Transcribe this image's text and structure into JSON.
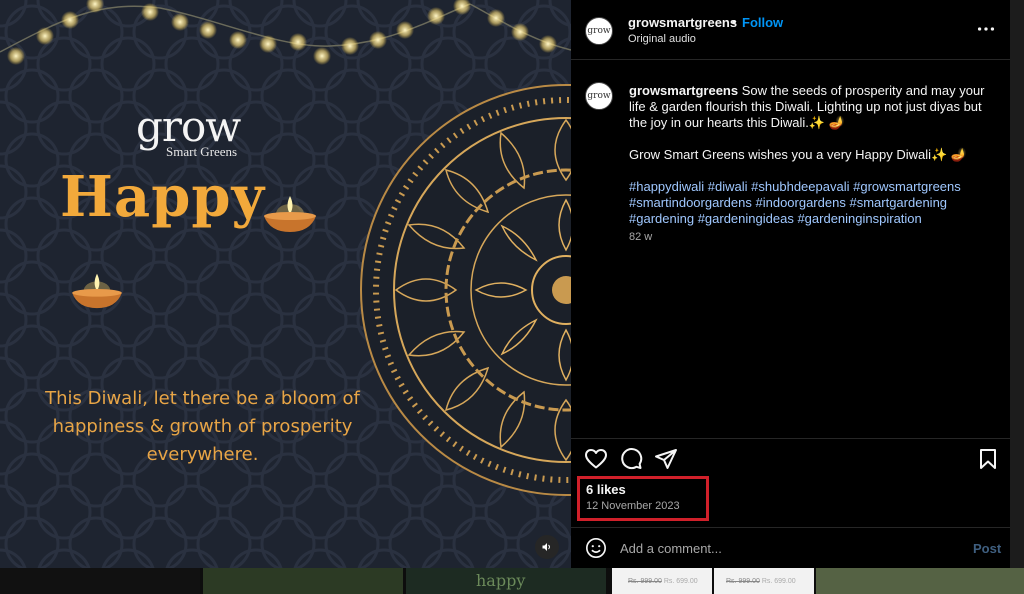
{
  "post": {
    "username": "growsmartgreens",
    "follow_label": "Follow",
    "separator": "•",
    "audio": "Original audio",
    "avatar_text": "grow",
    "more_icon": "more-horizontal-icon"
  },
  "media": {
    "brand_main": "grow",
    "brand_sub": "Smart Greens",
    "headline": "Happy",
    "tagline_line1": "This Diwali, let there be a bloom of",
    "tagline_line2": "happiness & growth of prosperity",
    "tagline_line3": "everywhere.",
    "sound_icon": "speaker-icon",
    "colors": {
      "gold": "#f2a93b",
      "background": "#1e2430"
    }
  },
  "caption": {
    "username": "growsmartgreens",
    "text1": "Sow the seeds of prosperity and may your life & garden flourish this Diwali. Lighting up not just diyas but the joy in our hearts this Diwali.✨ 🪔",
    "text2": "Grow Smart Greens wishes you a very Happy Diwali✨ 🪔",
    "hashtags": [
      "#happydiwali",
      "#diwali",
      "#shubhdeepavali",
      "#growsmartgreens",
      "#smartindoorgardens",
      "#indoorgardens",
      "#smartgardening",
      "#gardening",
      "#gardeningideas",
      "#gardeninginspiration"
    ],
    "time_ago": "82 w"
  },
  "actions": {
    "like_icon": "heart-icon",
    "comment_icon": "comment-icon",
    "share_icon": "send-icon",
    "save_icon": "bookmark-icon"
  },
  "stats": {
    "likes": "6 likes",
    "date": "12 November 2023"
  },
  "comment": {
    "placeholder": "Add a comment...",
    "post_label": "Post",
    "emoji_icon": "emoji-icon"
  },
  "background": {
    "prices": [
      {
        "old": "Rs. 999.00",
        "new": "Rs. 699.00"
      },
      {
        "old": "Rs. 999.00",
        "new": "Rs. 699.00"
      }
    ],
    "tile_text": "happy"
  }
}
